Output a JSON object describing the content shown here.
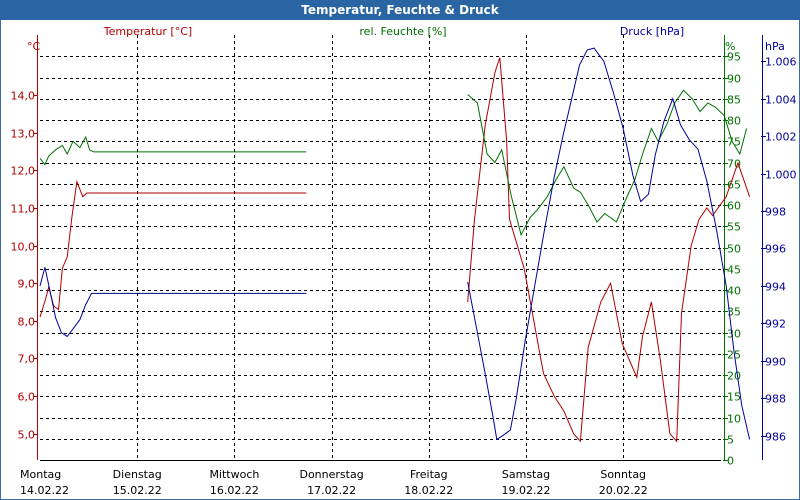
{
  "title": "Temperatur, Feuchte & Druck",
  "colors": {
    "titlebar": "#2a65a3",
    "temperature": "#b00000",
    "humidity": "#007000",
    "pressure": "#00009a",
    "grid": "#000000"
  },
  "chart_data": {
    "type": "line",
    "x_labels": [
      {
        "day": "Montag",
        "date": "14.02.22"
      },
      {
        "day": "Dienstag",
        "date": "15.02.22"
      },
      {
        "day": "Mittwoch",
        "date": "16.02.22"
      },
      {
        "day": "Donnerstag",
        "date": "17.02.22"
      },
      {
        "day": "Freitag",
        "date": "18.02.22"
      },
      {
        "day": "Samstag",
        "date": "19.02.22"
      },
      {
        "day": "Sonntag",
        "date": "20.02.22"
      }
    ],
    "axes": {
      "temperature": {
        "label": "Temperatur [°C]",
        "unit": "°C",
        "ylim": [
          4.3,
          15.6
        ],
        "ticks": [
          5.0,
          6.0,
          7.0,
          8.0,
          9.0,
          10.0,
          11.0,
          12.0,
          13.0,
          14.0
        ],
        "tick_labels": [
          "5,0",
          "6,0",
          "7,0",
          "8,0",
          "9,0",
          "10,0",
          "11,0",
          "12,0",
          "13,0",
          "14,0"
        ]
      },
      "humidity": {
        "label": "rel. Feuchte [%]",
        "unit": "%",
        "ylim": [
          0,
          100
        ],
        "ticks": [
          0,
          5,
          10,
          15,
          20,
          25,
          30,
          35,
          40,
          45,
          50,
          55,
          60,
          65,
          70,
          75,
          80,
          85,
          90,
          95
        ],
        "tick_labels": [
          "0",
          "5",
          "10",
          "15",
          "20",
          "25",
          "30",
          "35",
          "40",
          "45",
          "50",
          "55",
          "60",
          "65",
          "70",
          "75",
          "80",
          "85",
          "90",
          "95"
        ]
      },
      "pressure": {
        "label": "Druck [hPa]",
        "unit": "hPa",
        "ylim": [
          984.7,
          1007.4
        ],
        "ticks": [
          986,
          988,
          990,
          992,
          994,
          996,
          998,
          1000,
          1002,
          1004,
          1006
        ],
        "tick_labels": [
          "986",
          "988",
          "990",
          "992",
          "994",
          "996",
          "998",
          "1.000",
          "1.002",
          "1.004",
          "1.006"
        ]
      }
    },
    "x_range": [
      0,
      7.0
    ],
    "series": [
      {
        "name": "Temperatur [°C]",
        "axis": "temperature",
        "color": "#b00000",
        "segments": [
          [
            [
              0.0,
              8.1
            ],
            [
              0.06,
              8.6
            ],
            [
              0.09,
              8.9
            ],
            [
              0.14,
              8.4
            ],
            [
              0.19,
              8.3
            ],
            [
              0.23,
              9.4
            ],
            [
              0.28,
              9.7
            ],
            [
              0.33,
              10.8
            ],
            [
              0.38,
              11.7
            ],
            [
              0.44,
              11.3
            ],
            [
              0.48,
              11.4
            ],
            [
              2.74,
              11.4
            ]
          ],
          [
            [
              4.4,
              8.5
            ],
            [
              4.47,
              10.7
            ],
            [
              4.58,
              13.2
            ],
            [
              4.68,
              14.6
            ],
            [
              4.73,
              15.0
            ],
            [
              4.8,
              12.8
            ],
            [
              4.83,
              10.7
            ],
            [
              4.98,
              9.4
            ],
            [
              5.08,
              8.0
            ],
            [
              5.18,
              6.6
            ],
            [
              5.29,
              6.0
            ],
            [
              5.39,
              5.6
            ],
            [
              5.49,
              5.0
            ],
            [
              5.56,
              4.8
            ],
            [
              5.64,
              7.3
            ],
            [
              5.77,
              8.5
            ],
            [
              5.87,
              9.0
            ],
            [
              5.99,
              7.4
            ],
            [
              6.09,
              6.8
            ],
            [
              6.14,
              6.5
            ],
            [
              6.2,
              7.6
            ],
            [
              6.29,
              8.5
            ],
            [
              6.38,
              7.0
            ],
            [
              6.48,
              5.0
            ],
            [
              6.55,
              4.8
            ],
            [
              6.6,
              8.2
            ],
            [
              6.7,
              10.0
            ],
            [
              6.78,
              10.7
            ],
            [
              6.86,
              11.0
            ],
            [
              6.92,
              10.8
            ],
            [
              7.06,
              11.3
            ],
            [
              7.18,
              12.2
            ],
            [
              7.3,
              11.3
            ]
          ]
        ]
      },
      {
        "name": "rel. Feuchte [%]",
        "axis": "humidity",
        "color": "#007000",
        "segments": [
          [
            [
              0.0,
              71.0
            ],
            [
              0.05,
              69.5
            ],
            [
              0.09,
              71.5
            ],
            [
              0.16,
              73.0
            ],
            [
              0.23,
              74.0
            ],
            [
              0.28,
              72.0
            ],
            [
              0.34,
              75.0
            ],
            [
              0.41,
              73.5
            ],
            [
              0.47,
              76.0
            ],
            [
              0.51,
              73.0
            ],
            [
              0.55,
              72.5
            ],
            [
              2.74,
              72.5
            ]
          ],
          [
            [
              4.4,
              86.0
            ],
            [
              4.5,
              84.0
            ],
            [
              4.6,
              72.0
            ],
            [
              4.68,
              70.0
            ],
            [
              4.75,
              73.0
            ],
            [
              4.85,
              62.0
            ],
            [
              4.95,
              53.0
            ],
            [
              5.04,
              57.0
            ],
            [
              5.12,
              59.0
            ],
            [
              5.22,
              62.0
            ],
            [
              5.31,
              66.0
            ],
            [
              5.39,
              69.0
            ],
            [
              5.49,
              64.0
            ],
            [
              5.56,
              63.0
            ],
            [
              5.64,
              60.0
            ],
            [
              5.73,
              56.0
            ],
            [
              5.81,
              58.0
            ],
            [
              5.93,
              56.0
            ],
            [
              6.04,
              62.0
            ],
            [
              6.12,
              66.0
            ],
            [
              6.2,
              72.0
            ],
            [
              6.29,
              78.0
            ],
            [
              6.36,
              75.0
            ],
            [
              6.45,
              79.0
            ],
            [
              6.53,
              84.0
            ],
            [
              6.62,
              87.0
            ],
            [
              6.71,
              85.0
            ],
            [
              6.79,
              82.0
            ],
            [
              6.87,
              84.0
            ],
            [
              6.95,
              83.0
            ],
            [
              7.04,
              81.0
            ],
            [
              7.12,
              75.0
            ],
            [
              7.2,
              72.0
            ],
            [
              7.27,
              78.0
            ]
          ]
        ]
      },
      {
        "name": "Druck [hPa]",
        "axis": "pressure",
        "color": "#00009a",
        "segments": [
          [
            [
              0.0,
              994.0
            ],
            [
              0.05,
              995.0
            ],
            [
              0.1,
              993.8
            ],
            [
              0.16,
              992.3
            ],
            [
              0.22,
              991.5
            ],
            [
              0.28,
              991.3
            ],
            [
              0.34,
              991.7
            ],
            [
              0.41,
              992.2
            ],
            [
              0.47,
              993.0
            ],
            [
              0.53,
              993.6
            ],
            [
              0.58,
              993.6
            ],
            [
              2.74,
              993.6
            ]
          ],
          [
            [
              4.4,
              994.2
            ],
            [
              4.5,
              991.5
            ],
            [
              4.58,
              989.3
            ],
            [
              4.66,
              987.0
            ],
            [
              4.7,
              985.8
            ],
            [
              4.76,
              986.0
            ],
            [
              4.84,
              986.3
            ],
            [
              4.9,
              988.0
            ],
            [
              4.99,
              991.0
            ],
            [
              5.09,
              994.0
            ],
            [
              5.19,
              997.0
            ],
            [
              5.29,
              999.8
            ],
            [
              5.38,
              1002.0
            ],
            [
              5.47,
              1004.0
            ],
            [
              5.55,
              1005.8
            ],
            [
              5.63,
              1006.6
            ],
            [
              5.7,
              1006.7
            ],
            [
              5.8,
              1006.0
            ],
            [
              5.9,
              1004.3
            ],
            [
              6.0,
              1002.4
            ],
            [
              6.1,
              999.9
            ],
            [
              6.18,
              998.5
            ],
            [
              6.26,
              998.9
            ],
            [
              6.33,
              1001.0
            ],
            [
              6.42,
              1002.8
            ],
            [
              6.51,
              1004.0
            ],
            [
              6.59,
              1002.6
            ],
            [
              6.68,
              1001.8
            ],
            [
              6.77,
              1001.3
            ],
            [
              6.86,
              999.6
            ],
            [
              6.96,
              997.0
            ],
            [
              7.06,
              994.0
            ],
            [
              7.14,
              990.5
            ],
            [
              7.22,
              987.6
            ],
            [
              7.3,
              985.8
            ]
          ]
        ]
      }
    ]
  }
}
